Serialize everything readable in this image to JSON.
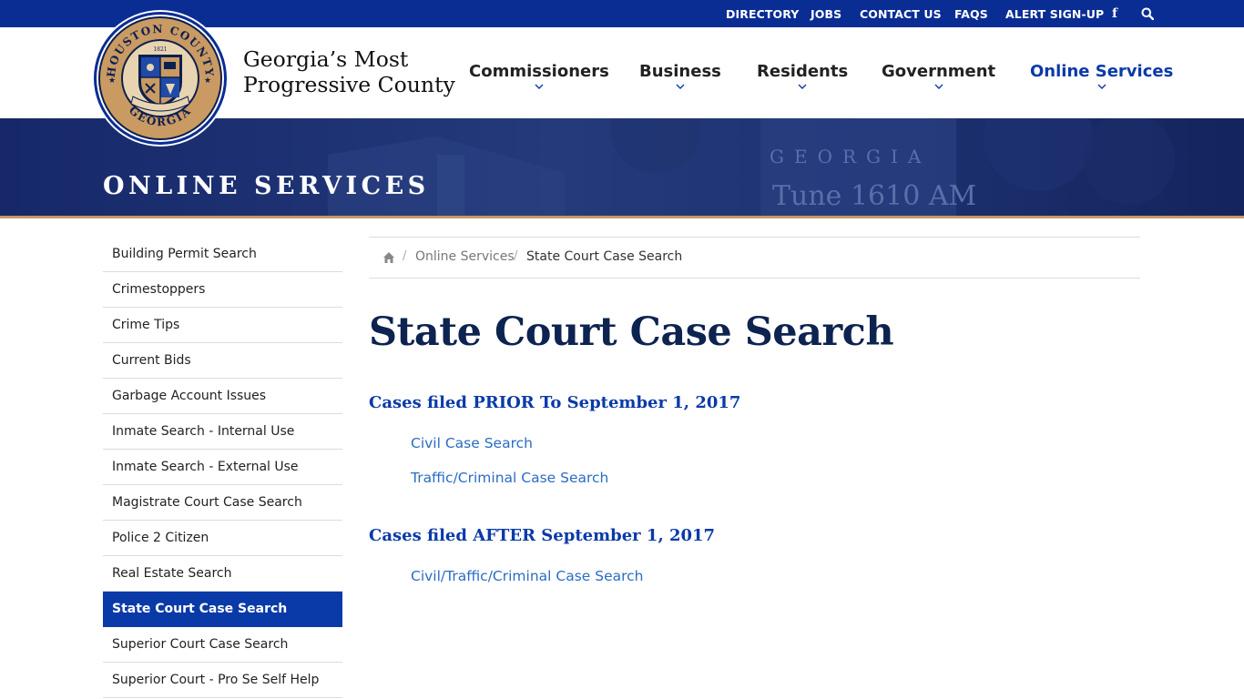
{
  "topbar": {
    "links": [
      "DIRECTORY",
      "JOBS",
      "CONTACT US",
      "FAQS",
      "ALERT SIGN-UP"
    ],
    "facebook_icon": "facebook-icon",
    "search_icon": "search-icon"
  },
  "seal": {
    "ring_text_top": "HOUSTON COUNTY",
    "ring_text_bottom": "GEORGIA",
    "year": "1821",
    "inner_text": "GEORGIA'S MOST PROGRESSIVE COUNTY"
  },
  "brand": {
    "line1": "Georgia’s Most",
    "line2": "Progressive County"
  },
  "nav": {
    "items": [
      "Commissioners",
      "Business",
      "Residents",
      "Government",
      "Online Services"
    ],
    "active": "Online Services"
  },
  "banner": {
    "title": "ONLINE SERVICES",
    "sign_line1": "GEORGIA",
    "sign_line2": "Tune 1610 AM"
  },
  "sidebar": {
    "items": [
      "Building Permit Search",
      "Crimestoppers",
      "Crime Tips",
      "Current Bids",
      "Garbage Account Issues",
      "Inmate Search - Internal Use",
      "Inmate Search - External Use",
      "Magistrate Court Case Search",
      "Police 2 Citizen",
      "Real Estate Search",
      "State Court Case Search",
      "Superior Court Case Search",
      "Superior Court - Pro Se Self Help"
    ],
    "active_index": 10
  },
  "breadcrumb": {
    "home_icon": "home-icon",
    "separator": "/",
    "link": "Online Services",
    "current": "State Court Case Search"
  },
  "main": {
    "title": "State Court Case Search",
    "section1_heading": "Cases filed PRIOR To September 1, 2017",
    "section1_links": [
      "Civil Case Search",
      "Traffic/Criminal Case Search"
    ],
    "section2_heading": "Cases filed AFTER September 1, 2017",
    "section2_links": [
      "Civil/Traffic/Criminal Case Search"
    ]
  },
  "colors": {
    "topbar": "#0a2d94",
    "active_blue": "#0a3aa8",
    "banner": "#13235a",
    "gold": "#c79a63",
    "title": "#0d2350",
    "link": "#2b6cc4"
  }
}
